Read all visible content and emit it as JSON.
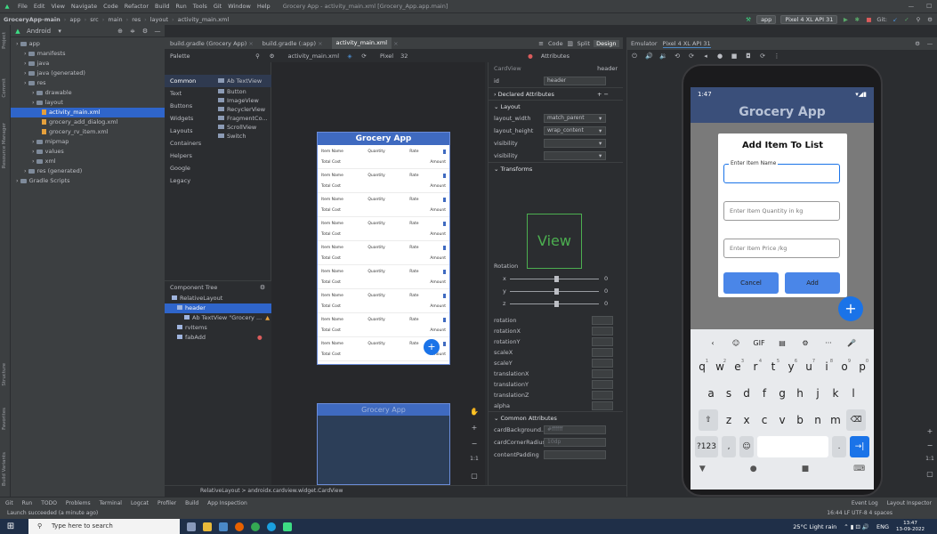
{
  "menubar": {
    "items": [
      "File",
      "Edit",
      "View",
      "Navigate",
      "Code",
      "Refactor",
      "Build",
      "Run",
      "Tools",
      "Git",
      "Window",
      "Help"
    ],
    "title": "Grocery App - activity_main.xml [Grocery_App.app.main]"
  },
  "navbar": {
    "crumbs": [
      "GroceryApp-main",
      "app",
      "src",
      "main",
      "res",
      "layout",
      "activity_main.xml"
    ],
    "run_config": "app",
    "device": "Pixel 4 XL API 31",
    "git": "Git:"
  },
  "project": {
    "view": "Android",
    "tree": [
      {
        "label": "app",
        "indent": 0,
        "type": "folder"
      },
      {
        "label": "manifests",
        "indent": 1,
        "type": "folder"
      },
      {
        "label": "java",
        "indent": 1,
        "type": "folder"
      },
      {
        "label": "java (generated)",
        "indent": 1,
        "type": "folder"
      },
      {
        "label": "res",
        "indent": 1,
        "type": "folder"
      },
      {
        "label": "drawable",
        "indent": 2,
        "type": "folder"
      },
      {
        "label": "layout",
        "indent": 2,
        "type": "folder"
      },
      {
        "label": "activity_main.xml",
        "indent": 3,
        "type": "file",
        "selected": true
      },
      {
        "label": "grocery_add_dialog.xml",
        "indent": 3,
        "type": "file"
      },
      {
        "label": "grocery_rv_item.xml",
        "indent": 3,
        "type": "file"
      },
      {
        "label": "mipmap",
        "indent": 2,
        "type": "folder"
      },
      {
        "label": "values",
        "indent": 2,
        "type": "folder"
      },
      {
        "label": "xml",
        "indent": 2,
        "type": "folder"
      },
      {
        "label": "res (generated)",
        "indent": 1,
        "type": "folder"
      },
      {
        "label": "Gradle Scripts",
        "indent": 0,
        "type": "folder"
      }
    ],
    "side_tabs": [
      "Project",
      "Commit",
      "Resource Manager",
      "Structure",
      "Favorites",
      "Build Variants"
    ]
  },
  "editor": {
    "tabs": [
      "build.gradle (Grocery App)",
      "build.gradle (:app)",
      "activity_main.xml"
    ],
    "active_tab": "activity_main.xml",
    "view_modes": [
      "Code",
      "Split",
      "Design"
    ],
    "toolbar": {
      "file": "activity_main.xml",
      "device": "Pixel",
      "api": "32"
    }
  },
  "palette": {
    "title": "Palette",
    "categories": [
      "Common",
      "Text",
      "Buttons",
      "Widgets",
      "Layouts",
      "Containers",
      "Helpers",
      "Google",
      "Legacy"
    ],
    "items": [
      "Ab TextView",
      "Button",
      "ImageView",
      "RecyclerView",
      "FragmentCo...",
      "ScrollView",
      "Switch"
    ]
  },
  "component_tree": {
    "title": "Component Tree",
    "rows": [
      {
        "label": "RelativeLayout",
        "selected": false
      },
      {
        "label": "header",
        "selected": true
      },
      {
        "label": "Ab TextView \"Grocery ...",
        "selected": false
      },
      {
        "label": "rvItems",
        "selected": false
      },
      {
        "label": "fabAdd",
        "selected": false
      }
    ]
  },
  "design": {
    "header": "Grocery App",
    "row_labels": {
      "name": "Item Name",
      "qty": "Quantity",
      "rate": "Rate",
      "cost": "Total Cost",
      "amount": "Amount"
    },
    "row_count": 9,
    "blueprint_header": "Grocery App",
    "fab": "+"
  },
  "attributes": {
    "title": "Attributes",
    "component": "CardView",
    "component_id": "header",
    "id_label": "id",
    "id_value": "header",
    "sections": {
      "declared": "Declared Attributes",
      "layout": "Layout",
      "transforms": "Transforms",
      "common": "Common Attributes"
    },
    "layout_rows": [
      {
        "label": "layout_width",
        "value": "match_parent"
      },
      {
        "label": "layout_height",
        "value": "wrap_content"
      },
      {
        "label": "visibility",
        "value": ""
      },
      {
        "label": "visibility",
        "value": ""
      }
    ],
    "view_preview": "View",
    "rotation_label": "Rotation",
    "rotation_axes": [
      {
        "axis": "x",
        "value": "0"
      },
      {
        "axis": "y",
        "value": "0"
      },
      {
        "axis": "z",
        "value": "0"
      }
    ],
    "transform_rows": [
      "rotation",
      "rotationX",
      "rotationY",
      "scaleX",
      "scaleY",
      "translationX",
      "translationY",
      "translationZ",
      "alpha"
    ],
    "common_rows": [
      {
        "label": "cardBackground...",
        "value": "#ffffff"
      },
      {
        "label": "cardCornerRadius",
        "value": "10dp"
      },
      {
        "label": "contentPadding",
        "value": ""
      }
    ]
  },
  "emulator": {
    "tab": "Emulator",
    "device_tab": "Pixel 4 XL API 31",
    "status_time": "1:47",
    "app_title": "Grocery App",
    "dialog": {
      "title": "Add Item To List",
      "name_hint": "Enter Item Name",
      "qty_hint": "Enter Item Quantity in kg",
      "price_hint": "Enter Item Price /kg",
      "cancel": "Cancel",
      "add": "Add"
    },
    "fab": "+",
    "keyboard": {
      "top_row": [
        "‹",
        "☺",
        "GIF",
        "▤",
        "⚙",
        "···",
        "🎤"
      ],
      "row1": [
        {
          "k": "q",
          "n": "1"
        },
        {
          "k": "w",
          "n": "2"
        },
        {
          "k": "e",
          "n": "3"
        },
        {
          "k": "r",
          "n": "4"
        },
        {
          "k": "t",
          "n": "5"
        },
        {
          "k": "y",
          "n": "6"
        },
        {
          "k": "u",
          "n": "7"
        },
        {
          "k": "i",
          "n": "8"
        },
        {
          "k": "o",
          "n": "9"
        },
        {
          "k": "p",
          "n": "0"
        }
      ],
      "row2": [
        "a",
        "s",
        "d",
        "f",
        "g",
        "h",
        "j",
        "k",
        "l"
      ],
      "row3": [
        "z",
        "x",
        "c",
        "v",
        "b",
        "n",
        "m"
      ],
      "symbols": "?123",
      "comma": ",",
      "period": "."
    }
  },
  "breadcrumb": "RelativeLayout  >  androidx.cardview.widget.CardView",
  "toolwindows": [
    "Git",
    "Run",
    "TODO",
    "Problems",
    "Terminal",
    "Logcat",
    "Profiler",
    "Build",
    "App Inspection"
  ],
  "toolwindows_right": [
    "Event Log",
    "Layout Inspector"
  ],
  "status": {
    "message": "Launch succeeded (a minute ago)",
    "right": "16:44  LF  UTF-8  4 spaces"
  },
  "taskbar": {
    "search_placeholder": "Type here to search",
    "weather": "25°C  Light rain",
    "lang": "ENG",
    "time": "13:47",
    "date": "13-09-2022"
  }
}
